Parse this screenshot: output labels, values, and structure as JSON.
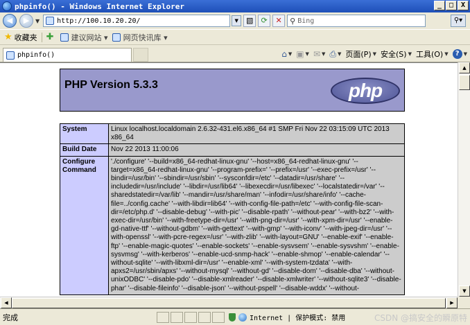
{
  "window": {
    "title": "phpinfo() - Windows Internet Explorer",
    "minimize": "_",
    "maximize": "□",
    "close": "X"
  },
  "navbar": {
    "url": "http://100.10.20.20/",
    "search_placeholder": "Bing"
  },
  "favorites": {
    "label": "收藏夹",
    "links": [
      "建议网站 ▾",
      "网页快讯库 ▾"
    ]
  },
  "tab": {
    "title": "phpinfo()"
  },
  "commands": {
    "page": "页面(P)",
    "safety": "安全(S)",
    "tools": "工具(O)"
  },
  "php": {
    "version_title": "PHP Version 5.3.3",
    "logo_text": "php",
    "rows": [
      {
        "key": "System",
        "value": "Linux localhost.localdomain 2.6.32-431.el6.x86_64 #1 SMP Fri Nov 22 03:15:09 UTC 2013 x86_64"
      },
      {
        "key": "Build Date",
        "value": "Nov 22 2013 11:00:06"
      },
      {
        "key": "Configure Command",
        "value": "'./configure' '--build=x86_64-redhat-linux-gnu' '--host=x86_64-redhat-linux-gnu' '--target=x86_64-redhat-linux-gnu' '--program-prefix=' '--prefix=/usr' '--exec-prefix=/usr' '--bindir=/usr/bin' '--sbindir=/usr/sbin' '--sysconfdir=/etc' '--datadir=/usr/share' '--includedir=/usr/include' '--libdir=/usr/lib64' '--libexecdir=/usr/libexec' '--localstatedir=/var' '--sharedstatedir=/var/lib' '--mandir=/usr/share/man' '--infodir=/usr/share/info' '--cache-file=../config.cache' '--with-libdir=lib64' '--with-config-file-path=/etc' '--with-config-file-scan-dir=/etc/php.d' '--disable-debug' '--with-pic' '--disable-rpath' '--without-pear' '--with-bz2' '--with-exec-dir=/usr/bin' '--with-freetype-dir=/usr' '--with-png-dir=/usr' '--with-xpm-dir=/usr' '--enable-gd-native-ttf' '--without-gdbm' '--with-gettext' '--with-gmp' '--with-iconv' '--with-jpeg-dir=/usr' '--with-openssl' '--with-pcre-regex=/usr' '--with-zlib' '--with-layout=GNU' '--enable-exif' '--enable-ftp' '--enable-magic-quotes' '--enable-sockets' '--enable-sysvsem' '--enable-sysvshm' '--enable-sysvmsg' '--with-kerberos' '--enable-ucd-snmp-hack' '--enable-shmop' '--enable-calendar' '--without-sqlite' '--with-libxml-dir=/usr' '--enable-xml' '--with-system-tzdata' '--with-apxs2=/usr/sbin/apxs' '--without-mysql' '--without-gd' '--disable-dom' '--disable-dba' '--without-unixODBC' '--disable-pdo' '--disable-xmlreader' '--disable-xmlwriter' '--without-sqlite3' '--disable-phar' '--disable-fileinfo' '--disable-json' '--without-pspell' '--disable-wddx' '--without-"
      }
    ]
  },
  "status": {
    "done": "完成",
    "zone": "Internet | 保护模式: 禁用",
    "watermark": "CSDN @搞安全的瞬原特"
  }
}
